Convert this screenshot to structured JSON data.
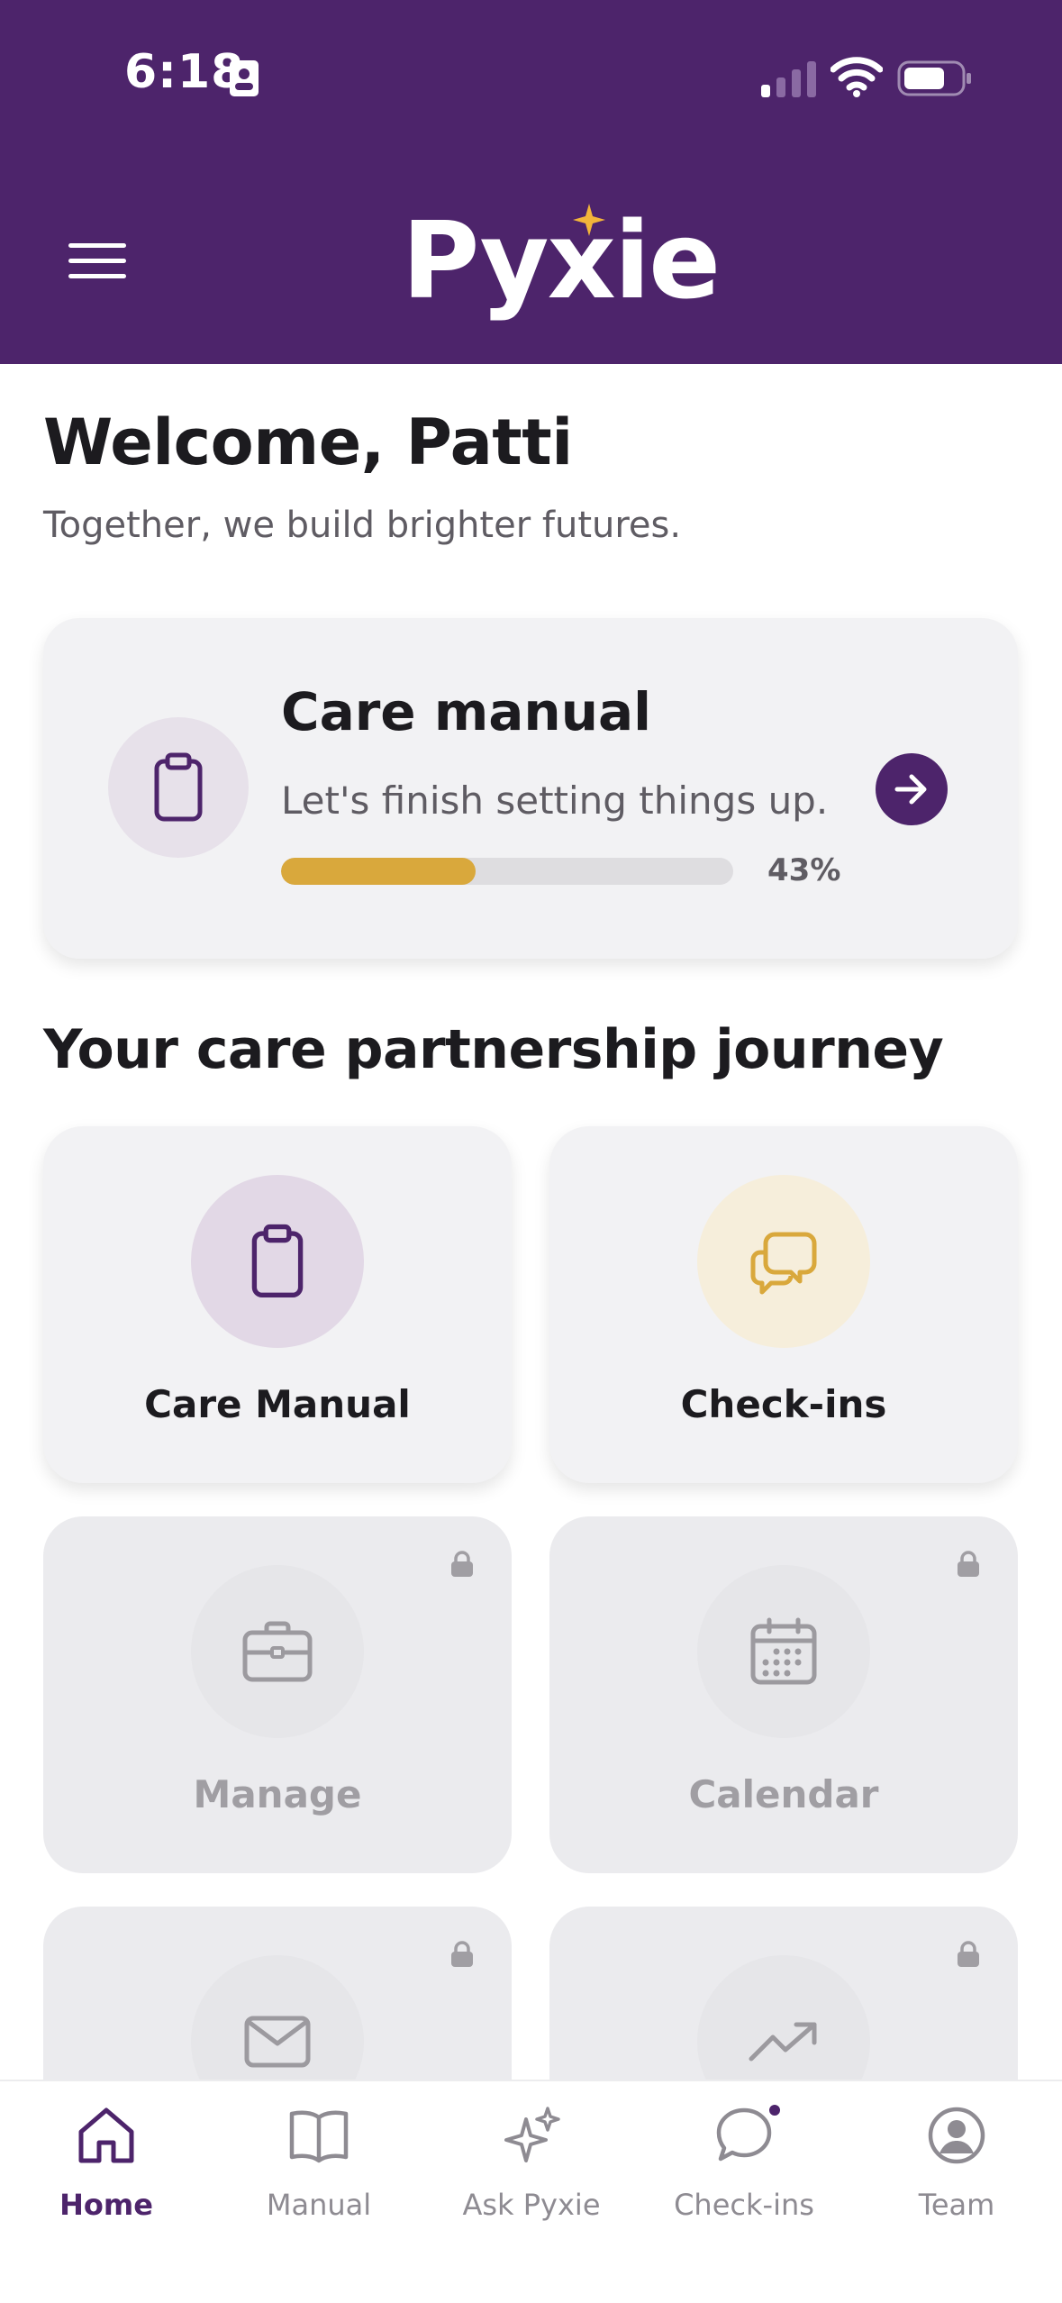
{
  "status_bar": {
    "time": "6:18"
  },
  "header": {
    "logo": "Pyxie",
    "menu_icon": "hamburger-menu-icon"
  },
  "welcome": {
    "title": "Welcome, Patti",
    "tagline": "Together, we build brighter futures."
  },
  "care_manual_card": {
    "title": "Care manual",
    "subtitle": "Let's finish setting things up.",
    "progress_percent": 43,
    "progress_label": "43%"
  },
  "journey": {
    "title": "Your care partnership journey",
    "tiles": [
      {
        "label": "Care Manual",
        "icon": "clipboard-icon",
        "locked": false
      },
      {
        "label": "Check-ins",
        "icon": "chat-bubbles-icon",
        "locked": false
      },
      {
        "label": "Manage",
        "icon": "briefcase-icon",
        "locked": true
      },
      {
        "label": "Calendar",
        "icon": "calendar-icon",
        "locked": true
      },
      {
        "label": "",
        "icon": "envelope-icon",
        "locked": true
      },
      {
        "label": "",
        "icon": "trending-up-icon",
        "locked": true
      }
    ]
  },
  "bottom_nav": {
    "items": [
      {
        "label": "Home",
        "icon": "home-icon",
        "active": true
      },
      {
        "label": "Manual",
        "icon": "book-icon",
        "active": false
      },
      {
        "label": "Ask Pyxie",
        "icon": "sparkles-icon",
        "active": false
      },
      {
        "label": "Check-ins",
        "icon": "chat-bubble-icon",
        "active": false
      },
      {
        "label": "Team",
        "icon": "person-circle-icon",
        "active": false
      }
    ]
  },
  "colors": {
    "brand_purple": "#4d246b",
    "accent_gold": "#d9a83c",
    "card_bg": "#f2f2f4",
    "locked_bg": "#ebebee"
  }
}
